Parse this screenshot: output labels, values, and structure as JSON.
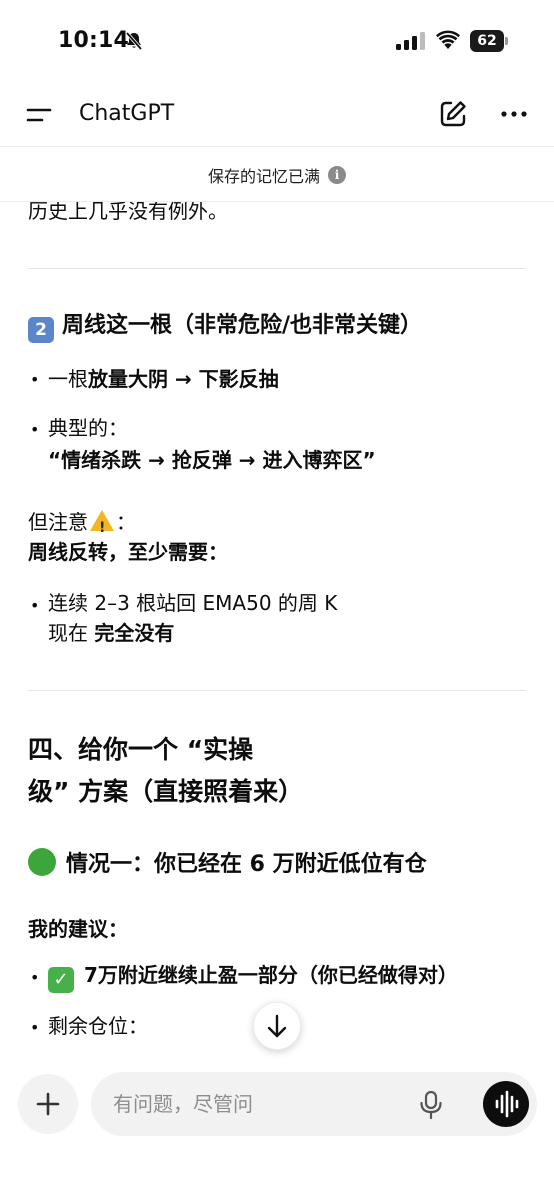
{
  "status_bar": {
    "time": "10:14",
    "battery": "62"
  },
  "header": {
    "title": "ChatGPT"
  },
  "memory_bar": {
    "text": "保存的记忆已满"
  },
  "content": {
    "p_top": "历史上几乎没有例外。",
    "section2_num": "2",
    "section2_title": "周线这一根（非常危险/也非常关键）",
    "b1_pre": "一根",
    "b1_bold": "放量大阴 → 下影反抽",
    "b2_label": "典型的：",
    "b2_quote": "“情绪杀跌 → 抢反弹 → 进入博弈区”",
    "note_pre": "但注意",
    "note_post": "：",
    "note_bold": "周线反转，至少需要：",
    "b3_line1": "连续 2–3 根站回 EMA50 的周 K",
    "b3_line2_pre": "现在 ",
    "b3_line2_bold": "完全没有",
    "h_four_line1": "四、给你一个 “实操",
    "h_four_line2": "级” 方案（直接照着来）",
    "case1_title": "情况一：你已经在 6 万附近低位有仓",
    "advice_label": "我的建议：",
    "b4_text": "7万附近继续止盈一部分（你已经做得对）",
    "b5_text": "剩余仓位："
  },
  "composer": {
    "placeholder": "有问题，尽管问"
  },
  "colors": {
    "keycap": "#5b86c9",
    "warning": "#f2b623",
    "green": "#3ca63a",
    "check": "#47b04b"
  },
  "icons": [
    "bell-slash-icon",
    "signal-icon",
    "wifi-icon",
    "battery-icon",
    "menu-icon",
    "edit-icon",
    "more-icon",
    "info-icon",
    "arrow-down-icon",
    "plus-icon",
    "mic-icon",
    "voice-wave-icon"
  ]
}
